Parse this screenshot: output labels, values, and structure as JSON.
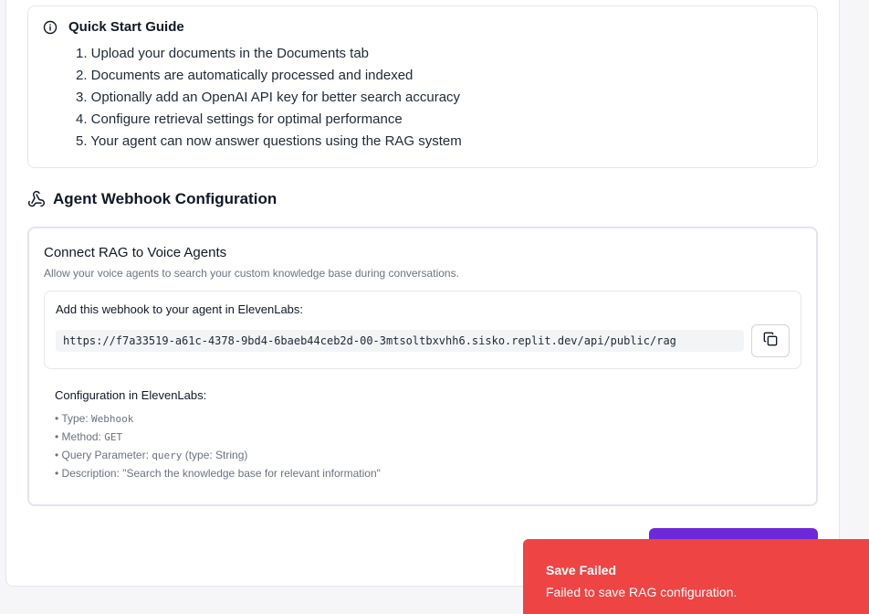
{
  "quick_start": {
    "title": "Quick Start Guide",
    "steps": [
      "1. Upload your documents in the Documents tab",
      "2. Documents are automatically processed and indexed",
      "3. Optionally add an OpenAI API key for better search accuracy",
      "4. Configure retrieval settings for optimal performance",
      "5. Your agent can now answer questions using the RAG system"
    ]
  },
  "webhook_section": {
    "title": "Agent Webhook Configuration",
    "card": {
      "title": "Connect RAG to Voice Agents",
      "description": "Allow your voice agents to search your custom knowledge base during conversations.",
      "url_label": "Add this webhook to your agent in ElevenLabs:",
      "url": "https://f7a33519-a61c-4378-9bd4-6baeb44ceb2d-00-3mtsoltbxvhh6.sisko.replit.dev/api/public/rag",
      "config_title": "Configuration in ElevenLabs:",
      "config_items": [
        {
          "prefix": "• Type: ",
          "code": "Webhook",
          "suffix": ""
        },
        {
          "prefix": "• Method: ",
          "code": "GET",
          "suffix": ""
        },
        {
          "prefix": "• Query Parameter: ",
          "code": "query",
          "suffix": " (type: String)"
        },
        {
          "prefix": "• Description: \"Search the knowledge base for relevant information\"",
          "code": "",
          "suffix": ""
        }
      ]
    }
  },
  "icons": {
    "info": "info-icon",
    "webhook": "webhook-icon",
    "copy": "copy-icon"
  },
  "colors": {
    "accent": "#6d28d9",
    "toast_bg": "#ef4444"
  },
  "toast": {
    "title": "Save Failed",
    "message": "Failed to save RAG configuration."
  }
}
